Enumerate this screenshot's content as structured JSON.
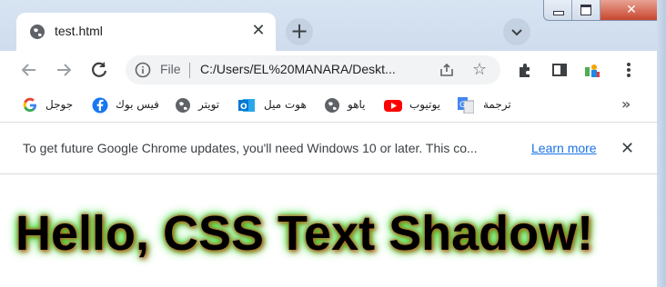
{
  "tab": {
    "title": "test.html",
    "close": "✕"
  },
  "newtab": "+",
  "toolbar": {
    "scheme": "File",
    "url": "C:/Users/EL%20MANARA/Deskt..."
  },
  "bookmarks": {
    "items": [
      {
        "label": "ترجمة",
        "icon": "google-translate-icon"
      },
      {
        "label": "يوتيوب",
        "icon": "youtube-icon"
      },
      {
        "label": "ياهو",
        "icon": "globe-icon"
      },
      {
        "label": "هوت ميل",
        "icon": "outlook-icon"
      },
      {
        "label": "تويتر",
        "icon": "globe-icon"
      },
      {
        "label": "فيس بوك",
        "icon": "facebook-icon"
      },
      {
        "label": "جوجل",
        "icon": "google-icon"
      }
    ],
    "more": "»"
  },
  "infobar": {
    "message": "To get future Google Chrome updates, you'll need Windows 10 or later. This co...",
    "link": "Learn more",
    "close": "✕"
  },
  "content": {
    "heading": "Hello, CSS Text Shadow!"
  },
  "colors": {
    "accent": "#1a73e8",
    "shadow_red": "#ff2a2a",
    "shadow_green": "#14e414"
  }
}
